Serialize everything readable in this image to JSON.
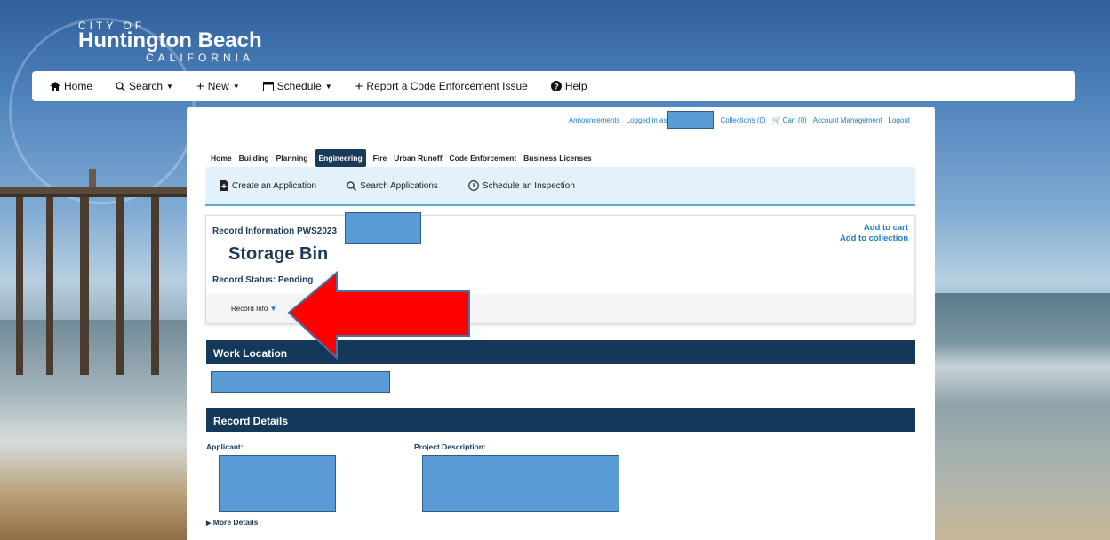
{
  "logo": {
    "line1": "CITY OF",
    "line2": "Huntington Beach",
    "line3": "CALIFORNIA"
  },
  "topnav": {
    "items": [
      {
        "icon": "home-icon",
        "label": "Home"
      },
      {
        "icon": "search-icon",
        "label": "Search"
      },
      {
        "icon": "plus-icon",
        "label": "New"
      },
      {
        "icon": "calendar-icon",
        "label": "Schedule"
      },
      {
        "icon": "plus-icon",
        "label": "Report a Code Enforcement Issue"
      },
      {
        "icon": "help-icon",
        "label": "Help"
      }
    ]
  },
  "toplinks": {
    "announcements": "Announcements",
    "logged_in": "Logged in as",
    "collections": "Collections (0)",
    "cart": "Cart (0)",
    "account": "Account Management",
    "logout": "Logout"
  },
  "tabs": [
    "Home",
    "Building",
    "Planning",
    "Engineering",
    "Fire",
    "Urban Runoff",
    "Code Enforcement",
    "Business Licenses"
  ],
  "active_tab": "Engineering",
  "subbar": {
    "create": "Create an Application",
    "search": "Search Applications",
    "schedule": "Schedule an Inspection"
  },
  "record": {
    "info_label": "Record Information PWS2023",
    "add_cart": "Add to cart",
    "add_collection": "Add to collection",
    "title": "Storage Bin",
    "status": "Record Status: Pending",
    "record_info": "Record Info"
  },
  "sections": {
    "work_location": "Work Location",
    "record_details": "Record Details",
    "applicant": "Applicant:",
    "project_description": "Project Description:",
    "more_details": "More Details"
  },
  "colors": {
    "header_navy": "#14385a",
    "link_blue": "#1e7bc4",
    "arrow_red": "#ff0000",
    "redaction": "#5b9bd5"
  }
}
